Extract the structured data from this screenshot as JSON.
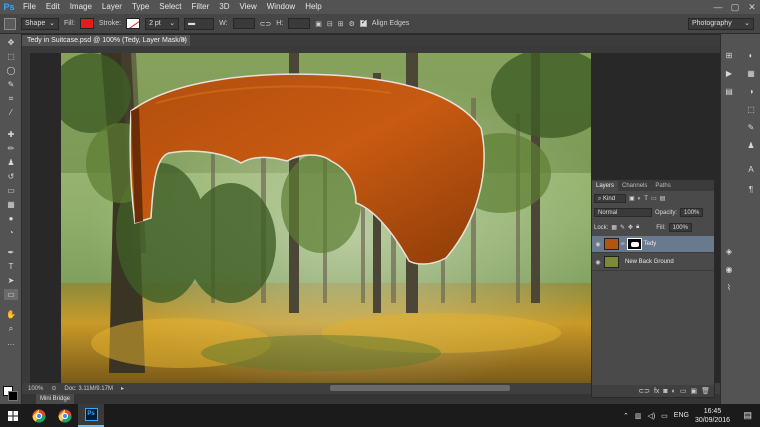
{
  "app": {
    "logo": "Ps"
  },
  "menu": [
    "File",
    "Edit",
    "Image",
    "Layer",
    "Type",
    "Select",
    "Filter",
    "3D",
    "View",
    "Window",
    "Help"
  ],
  "window_controls": {
    "minimize": "—",
    "maximize": "▢",
    "close": "✕"
  },
  "options": {
    "mode": "Shape",
    "fill_label": "Fill:",
    "stroke_label": "Stroke:",
    "stroke_width": "2 pt",
    "w_label": "W:",
    "h_label": "H:",
    "align_edges": "Align Edges",
    "workspace": "Photography",
    "fill_color": "#e01c1c"
  },
  "document": {
    "tab_title": "Tedy in Suitcase.psd @ 100% (Tedy, Layer Mask/8) *",
    "tab_close": "×"
  },
  "status": {
    "zoom": "100%",
    "doc": "Doc: 3.11M/9.17M"
  },
  "mini_bridge": "Mini Bridge",
  "layers_panel": {
    "tabs": [
      "Layers",
      "Channels",
      "Paths"
    ],
    "kind": "Kind",
    "blend_mode": "Normal",
    "opacity_label": "Opacity:",
    "opacity": "100%",
    "lock_label": "Lock:",
    "fill_label": "Fill:",
    "fill": "100%",
    "layers": [
      {
        "name": "Tedy",
        "active": true
      },
      {
        "name": "New Back Ground",
        "active": false
      }
    ]
  },
  "taskbar": {
    "language": "ENG",
    "time": "16:45",
    "date": "30/09/2016"
  }
}
